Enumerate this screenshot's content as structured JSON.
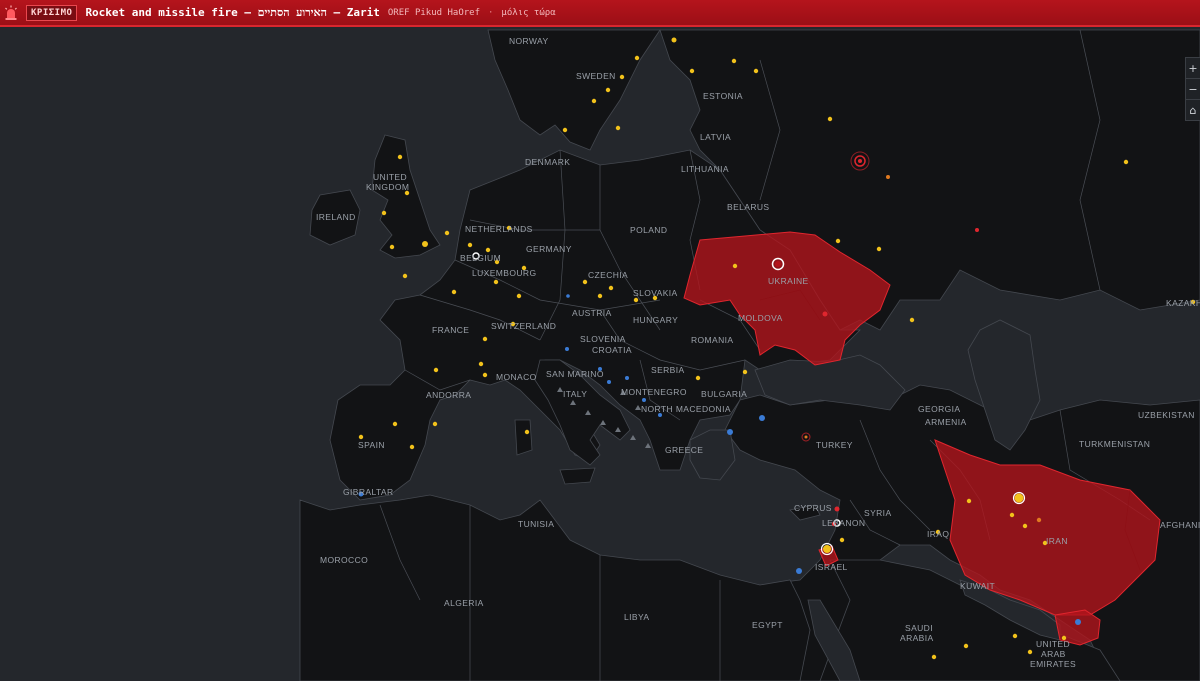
{
  "alert": {
    "badge": "ΚΡΙΣΙΜΟ",
    "title": "Rocket and missile fire — האירוע הסתיים — Zarit",
    "source": "OREF Pikud HaOref",
    "separator": "·",
    "time": "μόλις τώρα",
    "icon": "siren-icon",
    "color": "#b5141c"
  },
  "zoom": {
    "zoom_in_label": "+",
    "zoom_out_label": "−",
    "reset_label": "⌂"
  },
  "map": {
    "colors": {
      "land": "#121315",
      "sea": "#24272c",
      "borders": "#4a4e55",
      "hazard_fill": "#b3141c",
      "dot_yellow": "#f2c21b",
      "dot_blue": "#3a7bd5",
      "dot_red": "#e0262e"
    },
    "labels": [
      {
        "id": "norway",
        "text": "NORWAY"
      },
      {
        "id": "sweden",
        "text": "SWEDEN"
      },
      {
        "id": "estonia",
        "text": "ESTONIA"
      },
      {
        "id": "latvia",
        "text": "LATVIA"
      },
      {
        "id": "denmark",
        "text": "DENMARK"
      },
      {
        "id": "lithuania",
        "text": "LITHUANIA"
      },
      {
        "id": "united-kingdom-1",
        "text": "UNITED"
      },
      {
        "id": "united-kingdom-2",
        "text": "KINGDOM"
      },
      {
        "id": "belarus",
        "text": "BELARUS"
      },
      {
        "id": "ireland",
        "text": "IRELAND"
      },
      {
        "id": "netherlands",
        "text": "NETHERLANDS"
      },
      {
        "id": "poland",
        "text": "POLAND"
      },
      {
        "id": "germany",
        "text": "GERMANY"
      },
      {
        "id": "belgium",
        "text": "BELGIUM"
      },
      {
        "id": "luxembourg",
        "text": "LUXEMBOURG"
      },
      {
        "id": "czechia",
        "text": "CZECHIA"
      },
      {
        "id": "ukraine",
        "text": "UKRAINE"
      },
      {
        "id": "slovakia",
        "text": "SLOVAKIA"
      },
      {
        "id": "kazakhstan",
        "text": "KAZAKH"
      },
      {
        "id": "france",
        "text": "FRANCE"
      },
      {
        "id": "austria",
        "text": "AUSTRIA"
      },
      {
        "id": "switzerland",
        "text": "SWITZERLAND"
      },
      {
        "id": "hungary",
        "text": "HUNGARY"
      },
      {
        "id": "moldova",
        "text": "MOLDOVA"
      },
      {
        "id": "slovenia",
        "text": "SLOVENIA"
      },
      {
        "id": "croatia",
        "text": "CROATIA"
      },
      {
        "id": "romania",
        "text": "ROMANIA"
      },
      {
        "id": "monaco",
        "text": "MONACO"
      },
      {
        "id": "san-marino",
        "text": "SAN MARINO"
      },
      {
        "id": "serbia",
        "text": "SERBIA"
      },
      {
        "id": "montenegro",
        "text": "MONTENEGRO"
      },
      {
        "id": "bulgaria",
        "text": "BULGARIA"
      },
      {
        "id": "andorra",
        "text": "ANDORRA"
      },
      {
        "id": "italy",
        "text": "ITALY"
      },
      {
        "id": "north-macedonia",
        "text": "NORTH MACEDONIA"
      },
      {
        "id": "georgia",
        "text": "GEORGIA"
      },
      {
        "id": "armenia",
        "text": "ARMENIA"
      },
      {
        "id": "uzbekistan",
        "text": "UZBEKISTAN"
      },
      {
        "id": "spain",
        "text": "SPAIN"
      },
      {
        "id": "turkey",
        "text": "TURKEY"
      },
      {
        "id": "greece",
        "text": "GREECE"
      },
      {
        "id": "turkmenistan",
        "text": "TURKMENISTAN"
      },
      {
        "id": "gibraltar",
        "text": "GIBRALTAR"
      },
      {
        "id": "cyprus",
        "text": "CYPRUS"
      },
      {
        "id": "syria",
        "text": "SYRIA"
      },
      {
        "id": "tunisia",
        "text": "TUNISIA"
      },
      {
        "id": "lebanon",
        "text": "LEBANON"
      },
      {
        "id": "iraq",
        "text": "IRAQ"
      },
      {
        "id": "iran",
        "text": "IRAN"
      },
      {
        "id": "afghanistan",
        "text": "AFGHANIS"
      },
      {
        "id": "israel",
        "text": "ISRAEL"
      },
      {
        "id": "morocco",
        "text": "MOROCCO"
      },
      {
        "id": "kuwait",
        "text": "KUWAIT"
      },
      {
        "id": "algeria",
        "text": "ALGERIA"
      },
      {
        "id": "libya",
        "text": "LIBYA"
      },
      {
        "id": "egypt",
        "text": "EGYPT"
      },
      {
        "id": "saudi-arabia-1",
        "text": "SAUDI"
      },
      {
        "id": "saudi-arabia-2",
        "text": "ARABIA"
      },
      {
        "id": "uae-1",
        "text": "UNITED"
      },
      {
        "id": "uae-2",
        "text": "ARAB"
      },
      {
        "id": "uae-3",
        "text": "EMIRATES"
      }
    ]
  }
}
